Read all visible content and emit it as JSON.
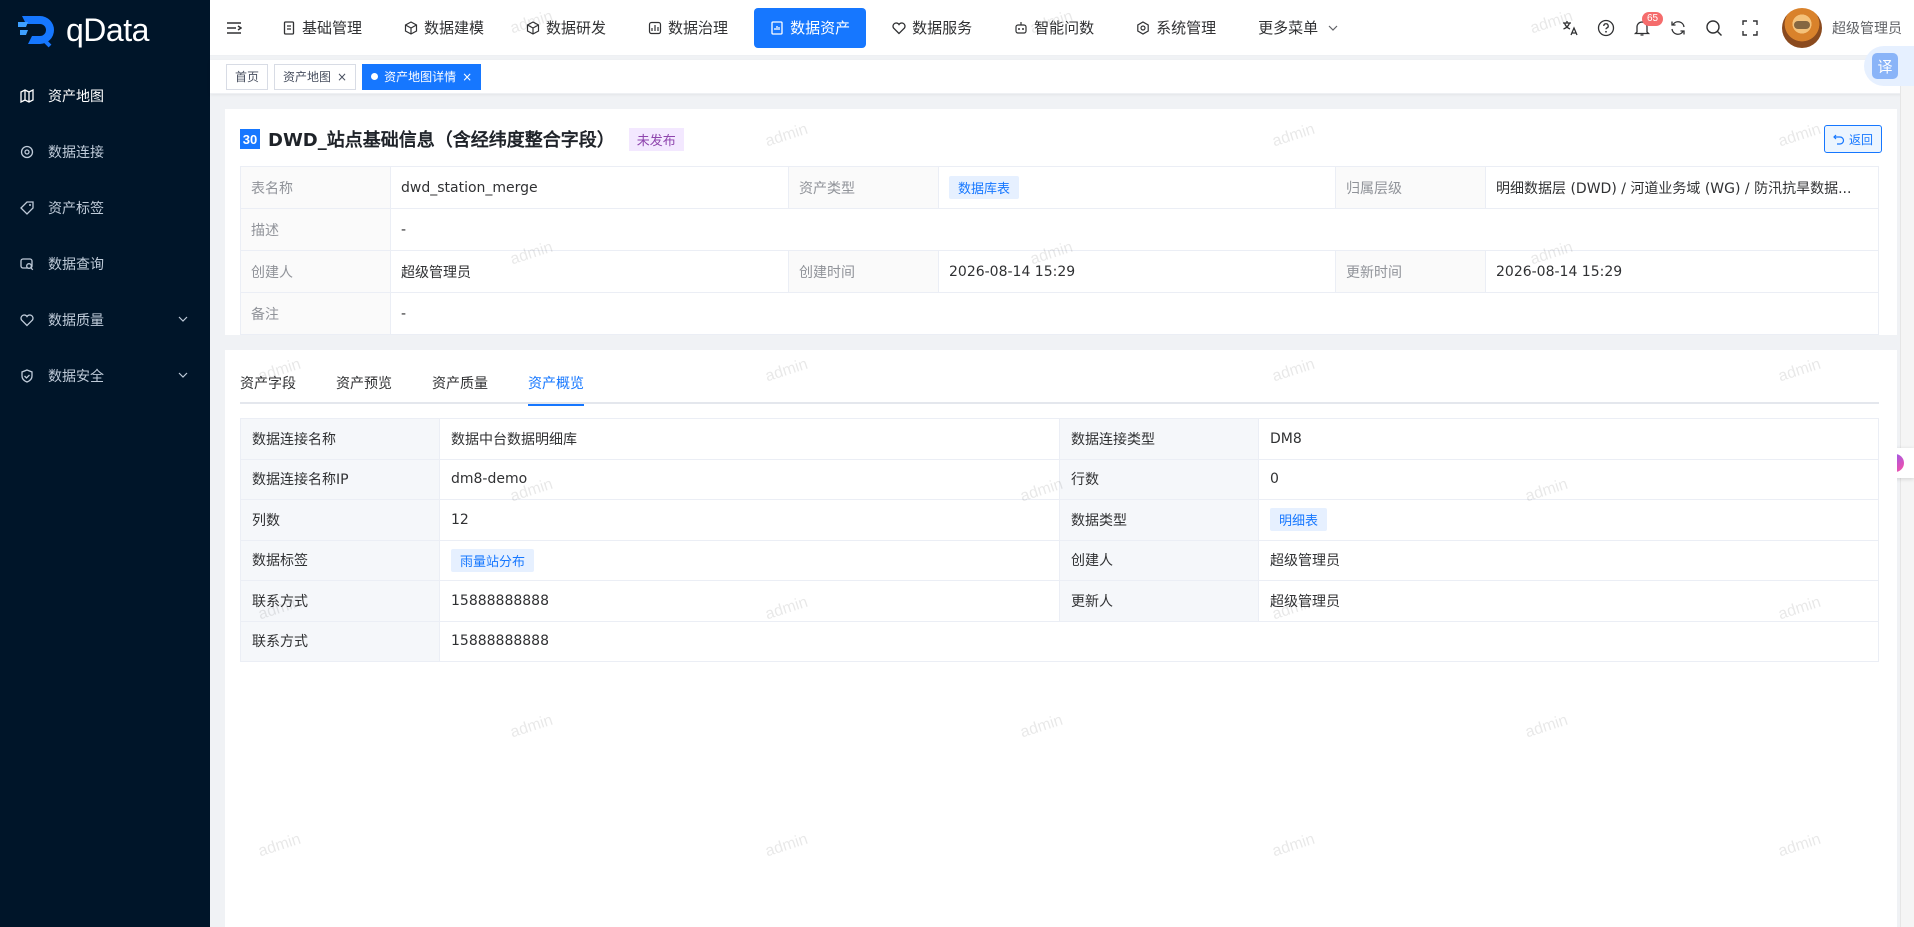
{
  "app": {
    "brand": "qData",
    "accent": "#1677ff",
    "sidebar_bg": "#001529"
  },
  "sidebar": {
    "items": [
      {
        "label": "资产地图",
        "icon": "map-icon",
        "active": true
      },
      {
        "label": "数据连接",
        "icon": "connection-icon"
      },
      {
        "label": "资产标签",
        "icon": "tag-icon"
      },
      {
        "label": "数据查询",
        "icon": "query-icon"
      },
      {
        "label": "数据质量",
        "icon": "quality-icon",
        "expandable": true
      },
      {
        "label": "数据安全",
        "icon": "shield-icon",
        "expandable": true
      }
    ]
  },
  "topnav": {
    "items": [
      {
        "label": "基础管理",
        "icon": "document-icon"
      },
      {
        "label": "数据建模",
        "icon": "cube-icon"
      },
      {
        "label": "数据研发",
        "icon": "cube-icon"
      },
      {
        "label": "数据治理",
        "icon": "governance-icon"
      },
      {
        "label": "数据资产",
        "icon": "asset-icon",
        "active": true
      },
      {
        "label": "数据服务",
        "icon": "heart-icon"
      },
      {
        "label": "智能问数",
        "icon": "robot-icon"
      },
      {
        "label": "系统管理",
        "icon": "settings-icon"
      },
      {
        "label": "更多菜单",
        "icon": "chevron-down-icon"
      }
    ],
    "notification_count": "65",
    "user_name": "超级管理员"
  },
  "tags": [
    {
      "label": "首页",
      "closable": false
    },
    {
      "label": "资产地图",
      "closable": true
    },
    {
      "label": "资产地图详情",
      "closable": true,
      "active": true
    }
  ],
  "float": {
    "translate_label": "译"
  },
  "asset": {
    "id": "30",
    "title": "DWD_站点基础信息（含经纬度整合字段）",
    "status": "未发布",
    "back_label": "返回",
    "fields": {
      "table_name_label": "表名称",
      "table_name": "dwd_station_merge",
      "asset_type_label": "资产类型",
      "asset_type": "数据库表",
      "layer_label": "归属层级",
      "layer": "明细数据层 (DWD) / 河道业务域 (WG) / 防汛抗旱数据...",
      "desc_label": "描述",
      "desc": "-",
      "creator_label": "创建人",
      "creator": "超级管理员",
      "created_label": "创建时间",
      "created": "2026-08-14 15:29",
      "updated_label": "更新时间",
      "updated": "2026-08-14 15:29",
      "remark_label": "备注",
      "remark": "-"
    }
  },
  "tabs": [
    {
      "label": "资产字段"
    },
    {
      "label": "资产预览"
    },
    {
      "label": "资产质量"
    },
    {
      "label": "资产概览",
      "active": true
    }
  ],
  "overview": {
    "conn_name_label": "数据连接名称",
    "conn_name": "数据中台数据明细库",
    "conn_type_label": "数据连接类型",
    "conn_type": "DM8",
    "conn_ip_label": "数据连接名称IP",
    "conn_ip": "dm8-demo",
    "rows_label": "行数",
    "rows": "0",
    "cols_label": "列数",
    "cols": "12",
    "data_type_label": "数据类型",
    "data_type": "明细表",
    "data_tag_label": "数据标签",
    "data_tag": "雨量站分布",
    "creator_label": "创建人",
    "creator": "超级管理员",
    "contact_label": "联系方式",
    "contact": "15888888888",
    "updater_label": "更新人",
    "updater": "超级管理员",
    "contact2_label": "联系方式",
    "contact2": "15888888888"
  },
  "watermark": "admin"
}
